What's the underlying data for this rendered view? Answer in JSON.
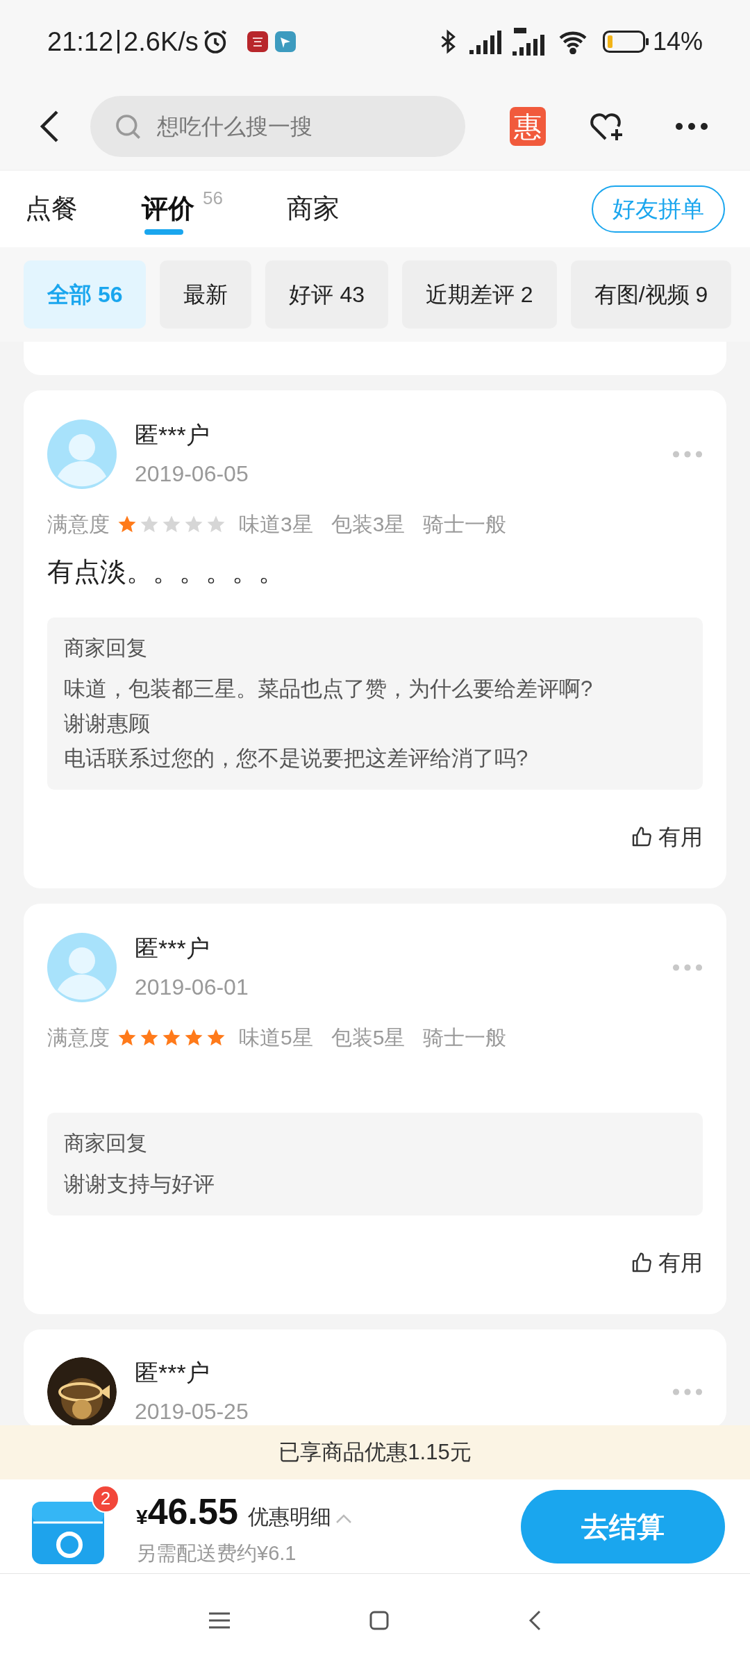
{
  "status_bar": {
    "time": "21:12",
    "speed": "2.6K/s",
    "battery": "14%"
  },
  "header": {
    "search_placeholder": "想吃什么搜一搜",
    "promo_badge": "惠"
  },
  "tabs": [
    {
      "label": "点餐",
      "selected": false
    },
    {
      "label": "评价",
      "count": "56",
      "selected": true
    },
    {
      "label": "商家",
      "selected": false
    }
  ],
  "friend_order_button": "好友拼单",
  "filters": [
    {
      "label": "全部 56",
      "selected": true
    },
    {
      "label": "最新",
      "selected": false
    },
    {
      "label": "好评 43",
      "selected": false
    },
    {
      "label": "近期差评 2",
      "selected": false
    },
    {
      "label": "有图/视频 9",
      "selected": false
    }
  ],
  "reviews": [
    {
      "user": "匿***户",
      "date": "2019-06-05",
      "satisfaction_label": "满意度",
      "stars": 1,
      "tags": [
        "味道3星",
        "包装3星",
        "骑士一般"
      ],
      "text": "有点淡。。。。。。",
      "reply": {
        "title": "商家回复",
        "lines": [
          "味道，包装都三星。菜品也点了赞，为什么要给差评啊?",
          "谢谢惠顾",
          "电话联系过您的，您不是说要把这差评给消了吗?"
        ]
      },
      "helpful": "有用"
    },
    {
      "user": "匿***户",
      "date": "2019-06-01",
      "satisfaction_label": "满意度",
      "stars": 5,
      "tags": [
        "味道5星",
        "包装5星",
        "骑士一般"
      ],
      "reply": {
        "title": "商家回复",
        "lines": [
          "谢谢支持与好评"
        ]
      },
      "helpful": "有用"
    },
    {
      "user": "匿***户",
      "date": "2019-05-25"
    }
  ],
  "discount_banner": "已享商品优惠1.15元",
  "cart": {
    "count": "2",
    "currency": "¥",
    "price": "46.55",
    "details": "优惠明细",
    "delivery": "另需配送费约¥6.1",
    "checkout": "去结算"
  }
}
